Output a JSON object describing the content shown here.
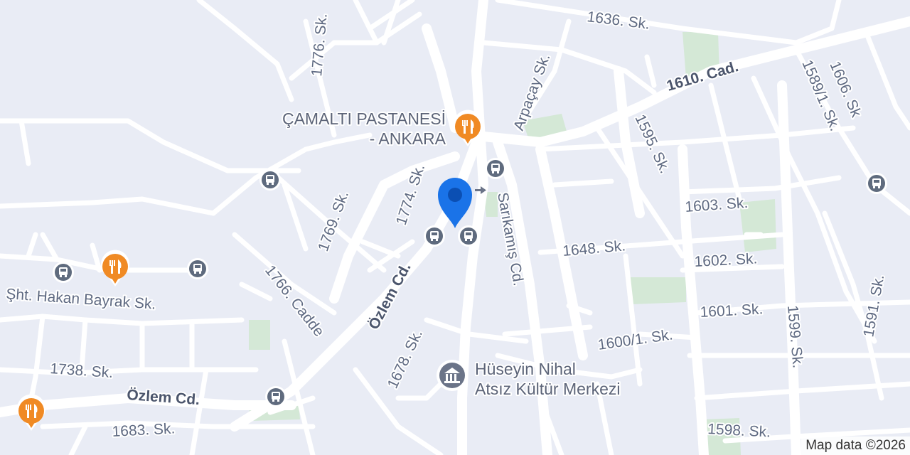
{
  "map": {
    "attribution": "Map data ©2026",
    "colors": {
      "background": "#e9ecf5",
      "road": "#ffffff",
      "park": "#d4e8d6",
      "restaurant_pin": "#f08a24",
      "transit_icon": "#5f6b7e",
      "location_pin": "#1a73e8",
      "museum_icon": "#6b7488"
    },
    "streets": {
      "s1636": "1636. Sk.",
      "s1776": "1776. Sk.",
      "arpacay": "Arpaçay Sk.",
      "cad1610": "1610. Cad.",
      "s1606": "1606. Sk",
      "s1589_1": "1589/1. Sk.",
      "s1595": "1595. Sk.",
      "s1774": "1774. Sk.",
      "sarikamis": "Sarıkamış Cd.",
      "s1603": "1603. Sk.",
      "s1769": "1769. Sk.",
      "s1648": "1648. Sk.",
      "s1602": "1602. Sk.",
      "sht_hakan": "Şht. Hakan Bayrak Sk.",
      "cadde1766": "1766. Cadde",
      "ozlem_cd_diag": "Özlem Cd.",
      "s1601": "1601. Sk.",
      "s1591": "1591. Sk.",
      "s1599": "1599. Sk.",
      "s1678": "1678. Sk.",
      "s1600_1": "1600/1. Sk.",
      "s1738": "1738. Sk.",
      "ozlem_cd": "Özlem Cd.",
      "s1683": "1683. Sk.",
      "s1598": "1598. Sk."
    },
    "pois": {
      "pastane_line1": "ÇAMALTI PASTANESİ",
      "pastane_line2": "- ANKARA",
      "kultur_line1": "Hüseyin Nihal",
      "kultur_line2": "Atsız Kültür Merkezi"
    },
    "icons": {
      "restaurant": "restaurant-icon",
      "bus": "bus-stop-icon",
      "location": "location-pin-icon",
      "museum": "museum-icon"
    }
  }
}
